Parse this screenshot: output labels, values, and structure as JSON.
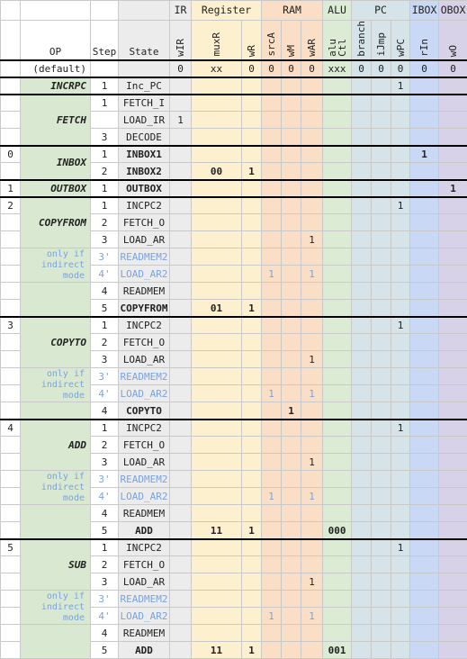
{
  "header": {
    "groups": [
      {
        "label": "",
        "key": "blank_left",
        "span": 4
      },
      {
        "label": "IR",
        "key": "ir",
        "span": 1
      },
      {
        "label": "Register",
        "key": "reg",
        "span": 2
      },
      {
        "label": "RAM",
        "key": "ram",
        "span": 3
      },
      {
        "label": "ALU",
        "key": "alu",
        "span": 1
      },
      {
        "label": "PC",
        "key": "pc",
        "span": 3
      },
      {
        "label": "IBOX",
        "key": "ibox",
        "span": 1
      },
      {
        "label": "OBOX",
        "key": "obox",
        "span": 1
      }
    ],
    "columns": [
      {
        "label": "",
        "key": "code"
      },
      {
        "label": "OP",
        "key": "op"
      },
      {
        "label": "Step",
        "key": "step"
      },
      {
        "label": "State",
        "key": "state"
      },
      {
        "label": "wIR",
        "key": "wIR"
      },
      {
        "label": "muxR",
        "key": "muxR"
      },
      {
        "label": "wR",
        "key": "wR"
      },
      {
        "label": "srcA",
        "key": "srcA"
      },
      {
        "label": "wM",
        "key": "wM"
      },
      {
        "label": "wAR",
        "key": "wAR"
      },
      {
        "label": "alu Ctl",
        "key": "aluCtl",
        "line1": "alu",
        "line2": "Ctl"
      },
      {
        "label": "branch",
        "key": "branch"
      },
      {
        "label": "iJmp",
        "key": "iJmp"
      },
      {
        "label": "wPC",
        "key": "wPC"
      },
      {
        "label": "rIn",
        "key": "rIn"
      },
      {
        "label": "wO",
        "key": "wO"
      }
    ]
  },
  "default_row": {
    "op": "(default)",
    "code": "",
    "step": "",
    "state": "",
    "wIR": "0",
    "muxR": "xx",
    "wR": "0",
    "srcA": "0",
    "wM": "0",
    "wAR": "0",
    "aluCtl": "xxx",
    "branch": "0",
    "iJmp": "0",
    "wPC": "0",
    "rIn": "0",
    "wO": "0"
  },
  "note_text": "only if indirect mode",
  "groups": [
    {
      "code": "",
      "op": "INCRPC",
      "rows": [
        {
          "step": "1",
          "state": "Inc_PC",
          "bold": false,
          "wPC": "1"
        }
      ]
    },
    {
      "code": "",
      "op": "FETCH",
      "rows": [
        {
          "step": "1",
          "state": "FETCH_I",
          "bold": false
        },
        {
          "step": "",
          "state": "LOAD_IR",
          "bold": false,
          "wIR": "1"
        },
        {
          "step": "3",
          "state": "DECODE",
          "bold": false
        }
      ]
    },
    {
      "code": "0",
      "op": "INBOX",
      "rows": [
        {
          "step": "1",
          "state": "INBOX1",
          "bold": true,
          "rIn": "1"
        },
        {
          "step": "2",
          "state": "INBOX2",
          "bold": true,
          "muxR": "00",
          "wR": "1"
        }
      ]
    },
    {
      "code": "1",
      "op": "OUTBOX",
      "rows": [
        {
          "step": "1",
          "state": "OUTBOX",
          "bold": true,
          "wO": "1"
        }
      ]
    },
    {
      "code": "2",
      "op": "COPYFROM",
      "rows": [
        {
          "step": "1",
          "state": "INCPC2",
          "bold": false,
          "wPC": "1"
        },
        {
          "step": "2",
          "state": "FETCH_O",
          "bold": false
        },
        {
          "step": "3",
          "state": "LOAD_AR",
          "bold": false,
          "wAR": "1"
        },
        {
          "step": "3'",
          "state": "READMEM2",
          "bold": false,
          "dim": true,
          "note": "start"
        },
        {
          "step": "4'",
          "state": "LOAD_AR2",
          "bold": false,
          "dim": true,
          "srcA": "1",
          "wAR": "1"
        },
        {
          "step": "4",
          "state": "READMEM",
          "bold": false
        },
        {
          "step": "5",
          "state": "COPYFROM",
          "bold": true,
          "muxR": "01",
          "wR": "1"
        }
      ]
    },
    {
      "code": "3",
      "op": "COPYTO",
      "rows": [
        {
          "step": "1",
          "state": "INCPC2",
          "bold": false,
          "wPC": "1"
        },
        {
          "step": "2",
          "state": "FETCH_O",
          "bold": false
        },
        {
          "step": "3",
          "state": "LOAD_AR",
          "bold": false,
          "wAR": "1"
        },
        {
          "step": "3'",
          "state": "READMEM2",
          "bold": false,
          "dim": true,
          "note": "start"
        },
        {
          "step": "4'",
          "state": "LOAD_AR2",
          "bold": false,
          "dim": true,
          "srcA": "1",
          "wAR": "1"
        },
        {
          "step": "4",
          "state": "COPYTO",
          "bold": true,
          "wM": "1"
        }
      ]
    },
    {
      "code": "4",
      "op": "ADD",
      "rows": [
        {
          "step": "1",
          "state": "INCPC2",
          "bold": false,
          "wPC": "1"
        },
        {
          "step": "2",
          "state": "FETCH_O",
          "bold": false
        },
        {
          "step": "3",
          "state": "LOAD_AR",
          "bold": false,
          "wAR": "1"
        },
        {
          "step": "3'",
          "state": "READMEM2",
          "bold": false,
          "dim": true,
          "note": "start"
        },
        {
          "step": "4'",
          "state": "LOAD_AR2",
          "bold": false,
          "dim": true,
          "srcA": "1",
          "wAR": "1"
        },
        {
          "step": "4",
          "state": "READMEM",
          "bold": false
        },
        {
          "step": "5",
          "state": "ADD",
          "bold": true,
          "muxR": "11",
          "wR": "1",
          "aluCtl": "000"
        }
      ]
    },
    {
      "code": "5",
      "op": "SUB",
      "rows": [
        {
          "step": "1",
          "state": "INCPC2",
          "bold": false,
          "wPC": "1"
        },
        {
          "step": "2",
          "state": "FETCH_O",
          "bold": false
        },
        {
          "step": "3",
          "state": "LOAD_AR",
          "bold": false,
          "wAR": "1"
        },
        {
          "step": "3'",
          "state": "READMEM2",
          "bold": false,
          "dim": true,
          "note": "start"
        },
        {
          "step": "4'",
          "state": "LOAD_AR2",
          "bold": false,
          "dim": true,
          "srcA": "1",
          "wAR": "1"
        },
        {
          "step": "4",
          "state": "READMEM",
          "bold": false
        },
        {
          "step": "5",
          "state": "ADD",
          "bold": true,
          "muxR": "11",
          "wR": "1",
          "aluCtl": "001"
        }
      ]
    }
  ],
  "colors": {
    "register": "#fdf0cf",
    "ram": "#fadfc6",
    "alu": "#dcebd4",
    "pc": "#d6e3e8",
    "ibox": "#c8d8f5",
    "obox": "#d8d2e8",
    "op": "#d9e8d0",
    "state": "#ececec",
    "note_text": "#7aa3dd"
  }
}
